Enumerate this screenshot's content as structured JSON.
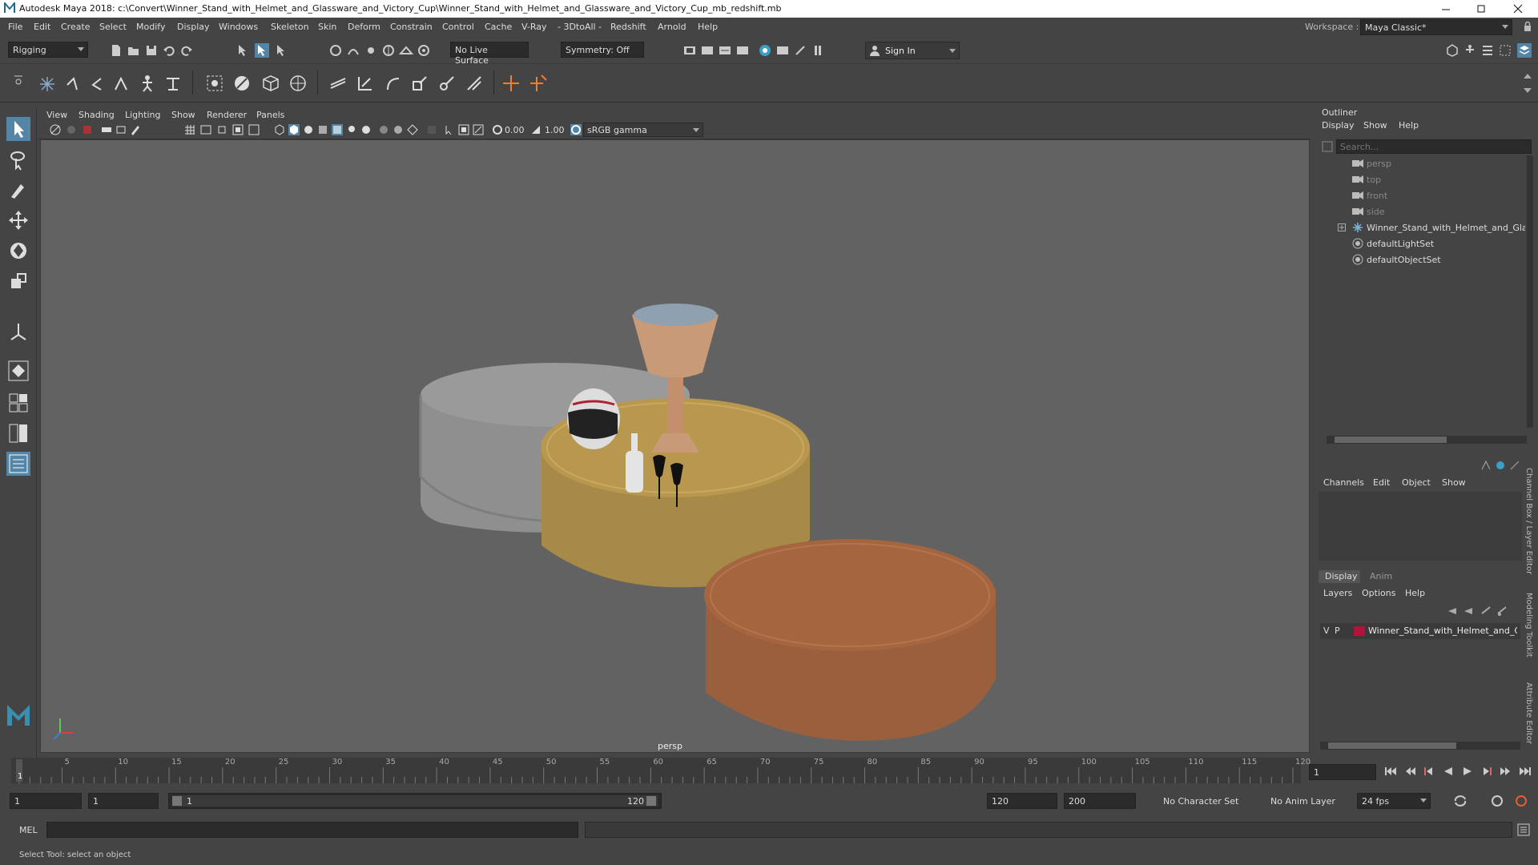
{
  "app": {
    "title": "Autodesk Maya 2018: c:\\Convert\\Winner_Stand_with_Helmet_and_Glassware_and_Victory_Cup\\Winner_Stand_with_Helmet_and_Glassware_and_Victory_Cup_mb_redshift.mb"
  },
  "menubar": {
    "items": [
      "File",
      "Edit",
      "Create",
      "Select",
      "Modify",
      "Display",
      "Windows",
      "Skeleton",
      "Skin",
      "Deform",
      "Constrain",
      "Control",
      "Cache",
      "V-Ray",
      "- 3DtoAll -",
      "Redshift",
      "Arnold",
      "Help"
    ],
    "workspace_label": "Workspace :",
    "workspace_value": "Maya Classic*"
  },
  "statusline": {
    "mode": "Rigging",
    "live_surface": "No Live Surface",
    "symmetry": "Symmetry: Off",
    "sign_in": "Sign In"
  },
  "panel": {
    "menus": [
      "View",
      "Shading",
      "Lighting",
      "Show",
      "Renderer",
      "Panels"
    ],
    "exposure": "0.00",
    "gamma": "1.00",
    "color_space": "sRGB gamma",
    "camera_label": "persp"
  },
  "outliner": {
    "title": "Outliner",
    "menus": [
      "Display",
      "Show",
      "Help"
    ],
    "search_placeholder": "Search...",
    "items": [
      {
        "label": "persp",
        "type": "camera",
        "dim": true
      },
      {
        "label": "top",
        "type": "camera",
        "dim": true
      },
      {
        "label": "front",
        "type": "camera",
        "dim": true
      },
      {
        "label": "side",
        "type": "camera",
        "dim": true
      },
      {
        "label": "Winner_Stand_with_Helmet_and_Glassv",
        "type": "group",
        "dim": false
      },
      {
        "label": "defaultLightSet",
        "type": "set",
        "dim": false
      },
      {
        "label": "defaultObjectSet",
        "type": "set",
        "dim": false
      }
    ]
  },
  "channelbox": {
    "menus": [
      "Channels",
      "Edit",
      "Object",
      "Show"
    ],
    "layer_tabs": [
      "Display",
      "Anim"
    ],
    "layer_menus": [
      "Layers",
      "Options",
      "Help"
    ],
    "layer": {
      "v": "V",
      "p": "P",
      "name": "Winner_Stand_with_Helmet_and_Gla",
      "color": "#b0143c"
    }
  },
  "side_tabs": [
    "Channel Box / Layer Editor",
    "Modeling Toolkit",
    "Attribute Editor"
  ],
  "timeline": {
    "ticks": [
      "5",
      "10",
      "15",
      "20",
      "25",
      "30",
      "35",
      "40",
      "45",
      "50",
      "55",
      "60",
      "65",
      "70",
      "75",
      "80",
      "85",
      "90",
      "95",
      "100",
      "105",
      "110",
      "115",
      "120"
    ],
    "current_frame_marker": "1",
    "current_frame_field": "1"
  },
  "range": {
    "start": "1",
    "playback_start": "1",
    "slider_start": "1",
    "slider_end": "120",
    "playback_end": "120",
    "end": "200",
    "character_set": "No Character Set",
    "anim_layer": "No Anim Layer",
    "fps": "24 fps"
  },
  "cmd": {
    "label": "MEL"
  },
  "help": {
    "text": "Select Tool: select an object"
  },
  "colors": {
    "accent": "#5285a6",
    "viewport_bg": "#626262",
    "gold": "#b8974f",
    "bronze": "#a4653f",
    "silver": "#9a9a9a"
  }
}
